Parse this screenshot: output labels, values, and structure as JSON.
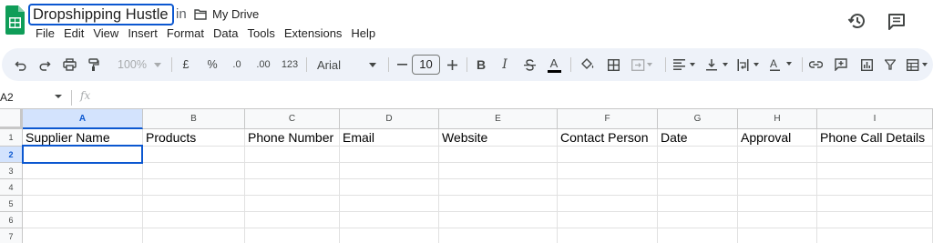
{
  "document": {
    "title": "Dropshipping Hustle",
    "in_label": "in",
    "folder_label": "My Drive"
  },
  "menu": [
    "File",
    "Edit",
    "View",
    "Insert",
    "Format",
    "Data",
    "Tools",
    "Extensions",
    "Help"
  ],
  "toolbar": {
    "zoom": "100%",
    "currency": "£",
    "percent": "%",
    "decrease_decimals": ".0",
    "increase_decimals": ".00",
    "number_format": "123",
    "font_family": "Arial",
    "font_size": "10",
    "bold": "B",
    "italic": "I",
    "text_color": "A",
    "highlight_color": "A"
  },
  "formula_bar": {
    "name_box": "A2",
    "fx": "fx"
  },
  "sheet": {
    "columns": [
      "A",
      "B",
      "C",
      "D",
      "E",
      "F",
      "G",
      "H",
      "I"
    ],
    "rows": [
      "1",
      "2",
      "3",
      "4",
      "5",
      "6",
      "7"
    ],
    "header_row": [
      "Supplier Name",
      "Products",
      "Phone Number",
      "Email",
      "Website",
      "Contact Person",
      "Date",
      "Approval",
      "Phone Call Details"
    ],
    "selected_cell": "A2"
  },
  "colors": {
    "accent": "#0b57d0",
    "selection_fill": "#d3e3fd",
    "toolbar_bg": "#eef2f9",
    "sheets_green": "#0f9d58"
  },
  "icons": [
    "sheets-logo-icon",
    "folder-icon",
    "history-icon",
    "comment-icon",
    "undo-icon",
    "redo-icon",
    "print-icon",
    "paint-format-icon",
    "paint-bucket-icon",
    "borders-icon",
    "merge-cells-icon",
    "align-left-icon",
    "valign-bottom-icon",
    "text-wrap-icon",
    "text-rotate-icon",
    "link-icon",
    "insert-comment-icon",
    "insert-chart-icon",
    "filter-icon",
    "table-view-icon"
  ]
}
